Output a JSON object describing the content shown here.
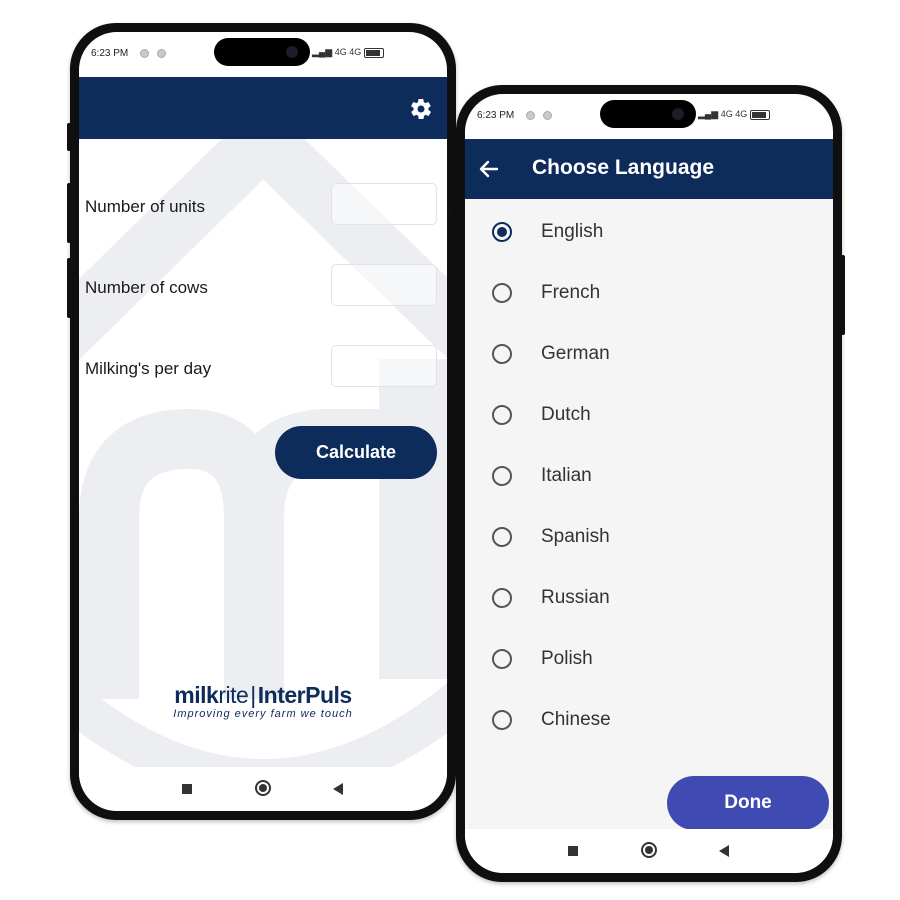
{
  "phone1": {
    "status": {
      "time": "6:23 PM",
      "network": "4G 4G"
    },
    "settings_icon": "gear-icon",
    "form": {
      "units_label": "Number of units",
      "cows_label": "Number of cows",
      "milkings_label": "Milking's per day",
      "units_value": "",
      "cows_value": "",
      "milkings_value": ""
    },
    "calculate_label": "Calculate",
    "logo": {
      "brand_a": "milk",
      "brand_b": "rite",
      "separator": "|",
      "brand_c": "InterPuls",
      "tagline": "Improving every farm we touch"
    },
    "colors": {
      "primary": "#0d2b5b"
    }
  },
  "phone2": {
    "status": {
      "time": "6:23 PM",
      "network": "4G 4G"
    },
    "back_icon": "arrow-left-icon",
    "title": "Choose Language",
    "languages": [
      {
        "label": "English",
        "selected": true
      },
      {
        "label": "French",
        "selected": false
      },
      {
        "label": "German",
        "selected": false
      },
      {
        "label": "Dutch",
        "selected": false
      },
      {
        "label": "Italian",
        "selected": false
      },
      {
        "label": "Spanish",
        "selected": false
      },
      {
        "label": "Russian",
        "selected": false
      },
      {
        "label": "Polish",
        "selected": false
      },
      {
        "label": "Chinese",
        "selected": false
      }
    ],
    "done_label": "Done",
    "colors": {
      "primary": "#0d2b5b",
      "done": "#3f4ab3"
    }
  }
}
